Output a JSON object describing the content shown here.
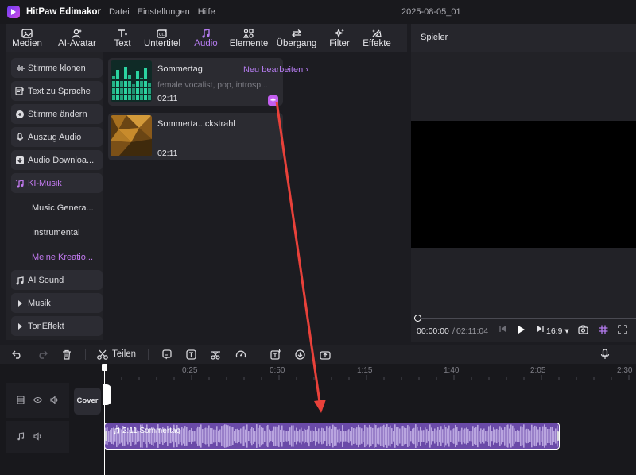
{
  "titlebar": {
    "app_name": "HitPaw Edimakor",
    "menu": [
      "Datei",
      "Einstellungen",
      "Hilfe"
    ],
    "project_title": "2025-08-05_01"
  },
  "toolbar": {
    "tools": [
      {
        "label": "Medien",
        "icon": "media-icon",
        "active": false
      },
      {
        "label": "AI-Avatar",
        "icon": "avatar-icon",
        "active": false
      },
      {
        "label": "Text",
        "icon": "text-icon",
        "active": false
      },
      {
        "label": "Untertitel",
        "icon": "subtitle-icon",
        "active": false
      },
      {
        "label": "Audio",
        "icon": "audio-icon",
        "active": true
      },
      {
        "label": "Elemente",
        "icon": "elements-icon",
        "active": false
      },
      {
        "label": "Übergang",
        "icon": "transition-icon",
        "active": false
      },
      {
        "label": "Filter",
        "icon": "filter-icon",
        "active": false
      },
      {
        "label": "Effekte",
        "icon": "effects-icon",
        "active": false
      }
    ]
  },
  "sidebar": {
    "items": [
      {
        "label": "Stimme klonen",
        "icon": "waveform-icon"
      },
      {
        "label": "Text zu Sprache",
        "icon": "text-to-speech-icon"
      },
      {
        "label": "Stimme ändern",
        "icon": "voice-change-icon"
      },
      {
        "label": "Auszug Audio",
        "icon": "microphone-icon"
      },
      {
        "label": "Audio Downloa...",
        "icon": "download-icon"
      },
      {
        "label": "KI-Musik",
        "icon": "ai-music-icon"
      },
      {
        "label": "Music Genera...",
        "icon": ""
      },
      {
        "label": "Instrumental",
        "icon": ""
      },
      {
        "label": "Meine Kreatio...",
        "icon": ""
      },
      {
        "label": "AI Sound",
        "icon": "ai-sound-icon"
      },
      {
        "label": "Musik",
        "icon": "caret-right-icon"
      },
      {
        "label": "TonEffekt",
        "icon": "caret-right-icon"
      }
    ]
  },
  "media": {
    "cards": [
      {
        "title": "Sommertag",
        "description": "female vocalist, pop, introsp...",
        "duration": "02:11",
        "edit_label": "Neu bearbeiten ›"
      },
      {
        "title": "Sommerta...ckstrahl",
        "description": "",
        "duration": "02:11"
      }
    ]
  },
  "player": {
    "title": "Spieler",
    "current_time": "00:00:00",
    "separator": "/",
    "total_time": "02:11:04",
    "aspect_ratio": "16:9 ▾"
  },
  "timeline_toolbar": {
    "split_label": "Teilen"
  },
  "timeline": {
    "ruler_ticks": [
      "0:25",
      "0:50",
      "1:15",
      "1:40",
      "2:05",
      "2:30"
    ],
    "cover_label": "Cover",
    "clip_label": "2:11 Sommertag"
  },
  "colors": {
    "accent": "#b57cf0",
    "clip_fill": "#6a4aa8",
    "wave": "#b9a5df",
    "arrow": "#e8413a"
  }
}
